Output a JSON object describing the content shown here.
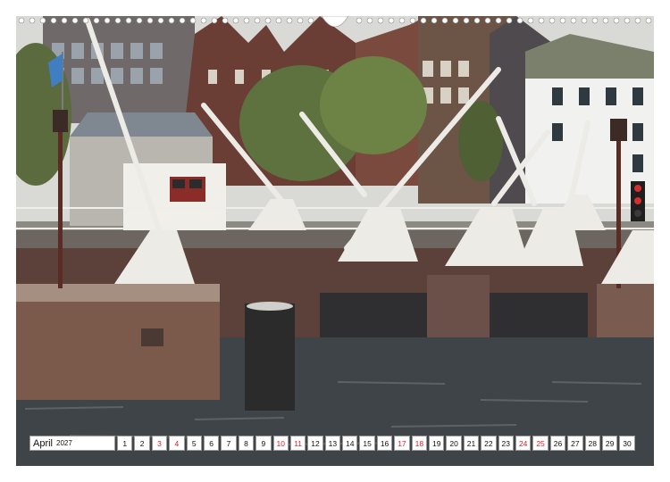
{
  "calendar": {
    "month": "April",
    "year": "2027",
    "days": [
      {
        "n": "1",
        "sunday": false
      },
      {
        "n": "2",
        "sunday": false
      },
      {
        "n": "3",
        "sunday": true
      },
      {
        "n": "4",
        "sunday": true
      },
      {
        "n": "5",
        "sunday": false
      },
      {
        "n": "6",
        "sunday": false
      },
      {
        "n": "7",
        "sunday": false
      },
      {
        "n": "8",
        "sunday": false
      },
      {
        "n": "9",
        "sunday": false
      },
      {
        "n": "10",
        "sunday": true
      },
      {
        "n": "11",
        "sunday": true
      },
      {
        "n": "12",
        "sunday": false
      },
      {
        "n": "13",
        "sunday": false
      },
      {
        "n": "14",
        "sunday": false
      },
      {
        "n": "15",
        "sunday": false
      },
      {
        "n": "16",
        "sunday": false
      },
      {
        "n": "17",
        "sunday": true
      },
      {
        "n": "18",
        "sunday": true
      },
      {
        "n": "19",
        "sunday": false
      },
      {
        "n": "20",
        "sunday": false
      },
      {
        "n": "21",
        "sunday": false
      },
      {
        "n": "22",
        "sunday": false
      },
      {
        "n": "23",
        "sunday": false
      },
      {
        "n": "24",
        "sunday": true
      },
      {
        "n": "25",
        "sunday": true
      },
      {
        "n": "26",
        "sunday": false
      },
      {
        "n": "27",
        "sunday": false
      },
      {
        "n": "28",
        "sunday": false
      },
      {
        "n": "29",
        "sunday": false
      },
      {
        "n": "30",
        "sunday": false
      }
    ]
  },
  "colors": {
    "weekend": "#d21f2a",
    "water": "#3f4448",
    "brick": "#6d4b3f",
    "crane": "#ecebe6"
  }
}
